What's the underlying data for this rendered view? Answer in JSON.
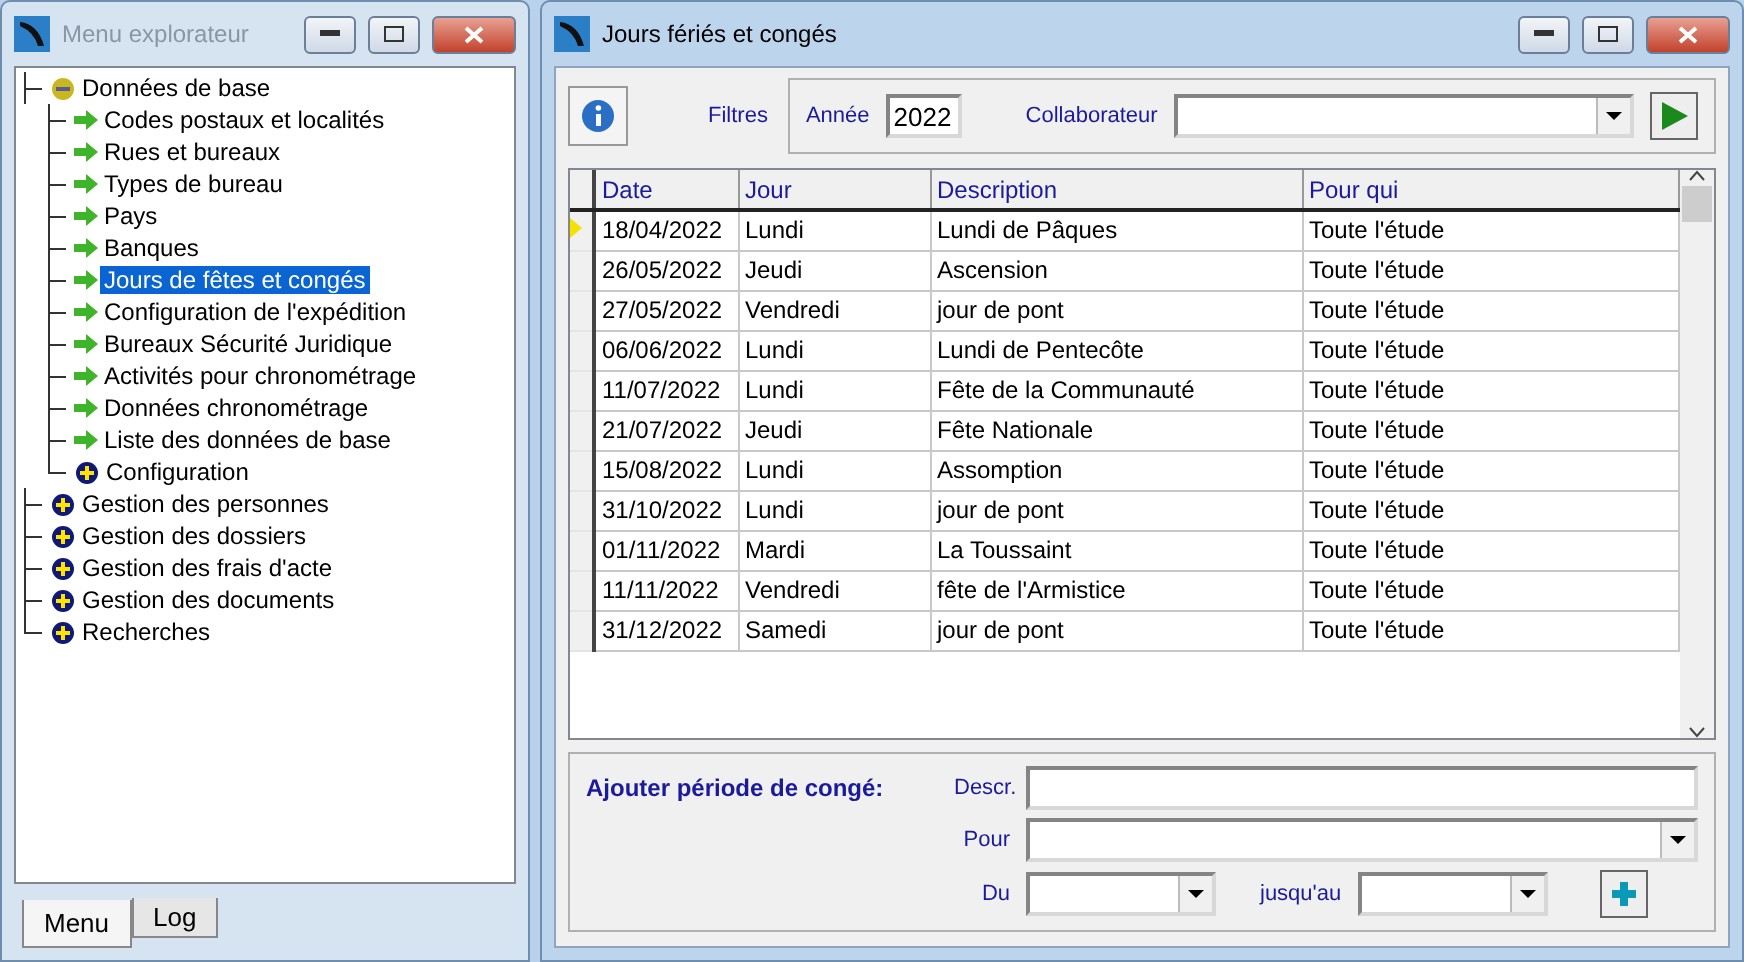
{
  "explorer": {
    "title": "Menu explorateur",
    "tree": [
      {
        "kind": "folder",
        "label": "Données de base",
        "expanded": true,
        "selected": false,
        "children": [
          {
            "kind": "item",
            "label": "Codes postaux et localités",
            "selected": false
          },
          {
            "kind": "item",
            "label": "Rues et bureaux",
            "selected": false
          },
          {
            "kind": "item",
            "label": "Types de bureau",
            "selected": false
          },
          {
            "kind": "item",
            "label": "Pays",
            "selected": false
          },
          {
            "kind": "item",
            "label": "Banques",
            "selected": false
          },
          {
            "kind": "item",
            "label": "Jours de fêtes et congés",
            "selected": true
          },
          {
            "kind": "item",
            "label": "Configuration de l'expédition",
            "selected": false
          },
          {
            "kind": "item",
            "label": "Bureaux Sécurité Juridique",
            "selected": false
          },
          {
            "kind": "item",
            "label": "Activités pour chronométrage",
            "selected": false
          },
          {
            "kind": "item",
            "label": "Données chronométrage",
            "selected": false
          },
          {
            "kind": "item",
            "label": "Liste des données de base",
            "selected": false
          },
          {
            "kind": "folder",
            "label": "Configuration",
            "expanded": false,
            "selected": false
          }
        ]
      },
      {
        "kind": "folder",
        "label": "Gestion des personnes",
        "expanded": false,
        "selected": false
      },
      {
        "kind": "folder",
        "label": "Gestion des dossiers",
        "expanded": false,
        "selected": false
      },
      {
        "kind": "folder",
        "label": "Gestion des frais d'acte",
        "expanded": false,
        "selected": false
      },
      {
        "kind": "folder",
        "label": "Gestion des documents",
        "expanded": false,
        "selected": false
      },
      {
        "kind": "folder",
        "label": "Recherches",
        "expanded": false,
        "selected": false
      }
    ],
    "tabs": [
      {
        "label": "Menu",
        "selected": true
      },
      {
        "label": "Log",
        "selected": false
      }
    ]
  },
  "holidays": {
    "title": "Jours fériés et congés",
    "filters": {
      "label": "Filtres",
      "year_label": "Année",
      "year": "2022",
      "collaborator_label": "Collaborateur"
    },
    "table": {
      "columns": [
        "Date",
        "Jour",
        "Description",
        "Pour qui"
      ],
      "rows": [
        {
          "cells": [
            "18/04/2022",
            "Lundi",
            "Lundi de Pâques",
            "Toute l'étude"
          ],
          "selected": true
        },
        {
          "cells": [
            "26/05/2022",
            "Jeudi",
            "Ascension",
            "Toute l'étude"
          ],
          "selected": false
        },
        {
          "cells": [
            "27/05/2022",
            "Vendredi",
            "jour de pont",
            "Toute l'étude"
          ],
          "selected": false
        },
        {
          "cells": [
            "06/06/2022",
            "Lundi",
            "Lundi de Pentecôte",
            "Toute l'étude"
          ],
          "selected": false
        },
        {
          "cells": [
            "11/07/2022",
            "Lundi",
            "Fête de la Communauté",
            "Toute l'étude"
          ],
          "selected": false
        },
        {
          "cells": [
            "21/07/2022",
            "Jeudi",
            "Fête Nationale",
            "Toute l'étude"
          ],
          "selected": false
        },
        {
          "cells": [
            "15/08/2022",
            "Lundi",
            "Assomption",
            "Toute l'étude"
          ],
          "selected": false
        },
        {
          "cells": [
            "31/10/2022",
            "Lundi",
            "jour de pont",
            "Toute l'étude"
          ],
          "selected": false
        },
        {
          "cells": [
            "01/11/2022",
            "Mardi",
            "La Toussaint",
            "Toute l'étude"
          ],
          "selected": false
        },
        {
          "cells": [
            "11/11/2022",
            "Vendredi",
            "fête de l'Armistice",
            "Toute l'étude"
          ],
          "selected": false
        },
        {
          "cells": [
            "31/12/2022",
            "Samedi",
            "jour de pont",
            "Toute l'étude"
          ],
          "selected": false
        }
      ]
    },
    "form": {
      "title": "Ajouter période de congé:",
      "descr_label": "Descr.",
      "pour_label": "Pour",
      "du_label": "Du",
      "jusqu_label": "jusqu'au"
    }
  }
}
